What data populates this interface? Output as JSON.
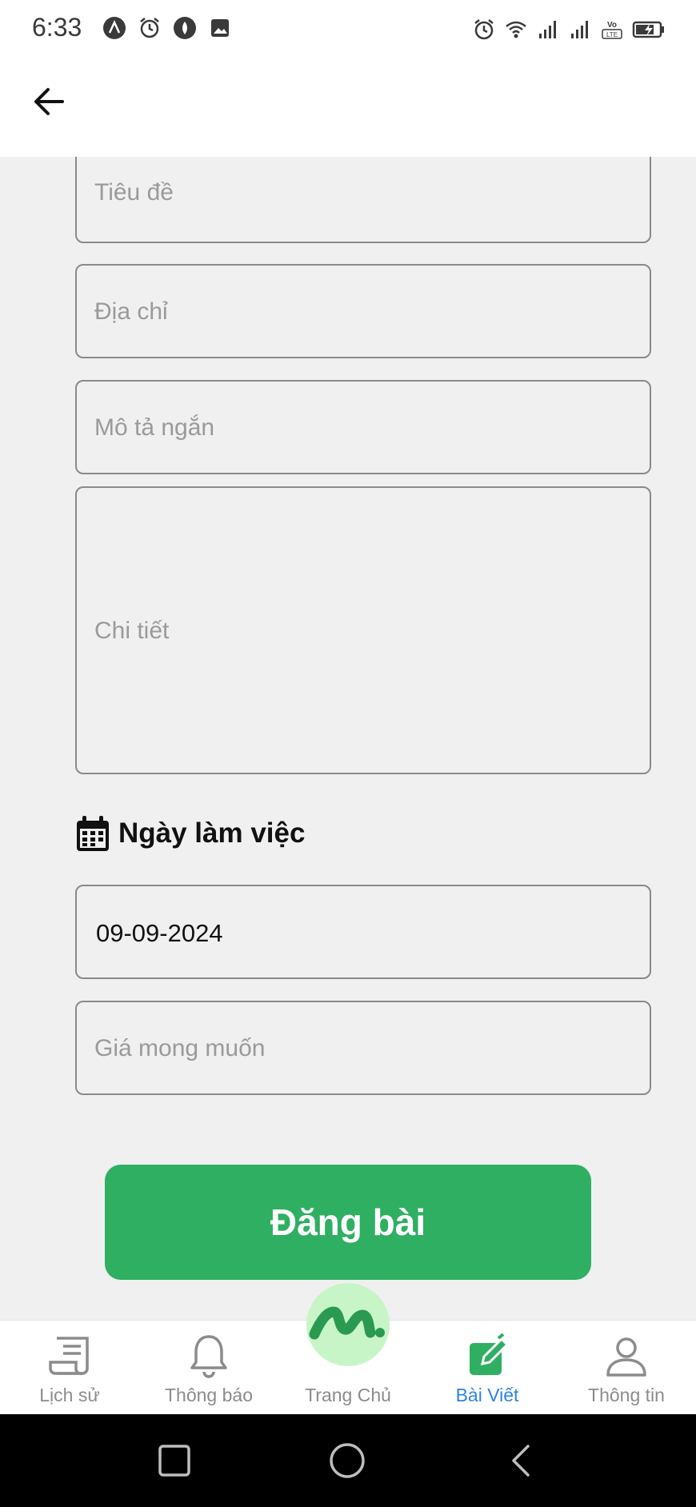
{
  "status_bar": {
    "time": "6:33",
    "left_icons": [
      "android-icon",
      "alarm-icon",
      "vpn-icon",
      "image-icon"
    ],
    "right_icons": [
      "alarm-icon",
      "wifi-icon",
      "signal-icon",
      "signal-icon",
      "volte-icon",
      "battery-charging-icon"
    ],
    "volte_label": "Vo LTE"
  },
  "app_bar": {
    "back_icon": "arrow-left-icon"
  },
  "form": {
    "title_placeholder": "Tiêu đề",
    "address_placeholder": "Địa chỉ",
    "short_desc_placeholder": "Mô tả ngắn",
    "detail_placeholder": "Chi tiết",
    "work_date_heading": "Ngày làm việc",
    "work_date_icon": "calendar-icon",
    "work_date_value": "09-09-2024",
    "price_placeholder": "Giá mong muốn",
    "submit_label": "Đăng bài"
  },
  "bottom_nav": {
    "items": [
      {
        "label": "Lịch sử",
        "icon": "history-icon",
        "active": false
      },
      {
        "label": "Thông báo",
        "icon": "bell-icon",
        "active": false
      },
      {
        "label": "Trang Chủ",
        "icon": "home-logo-icon",
        "active": false
      },
      {
        "label": "Bài Viết",
        "icon": "edit-post-icon",
        "active": true
      },
      {
        "label": "Thông tin",
        "icon": "profile-icon",
        "active": false
      }
    ]
  },
  "system_nav": {
    "buttons": [
      "recents-icon",
      "home-circle-icon",
      "back-triangle-icon"
    ]
  },
  "colors": {
    "primary_green": "#2faf62",
    "active_blue": "#2d82e6",
    "fab_bg": "#c8f5c8",
    "field_border": "#8a8a8a",
    "background": "#f0f0f0"
  }
}
